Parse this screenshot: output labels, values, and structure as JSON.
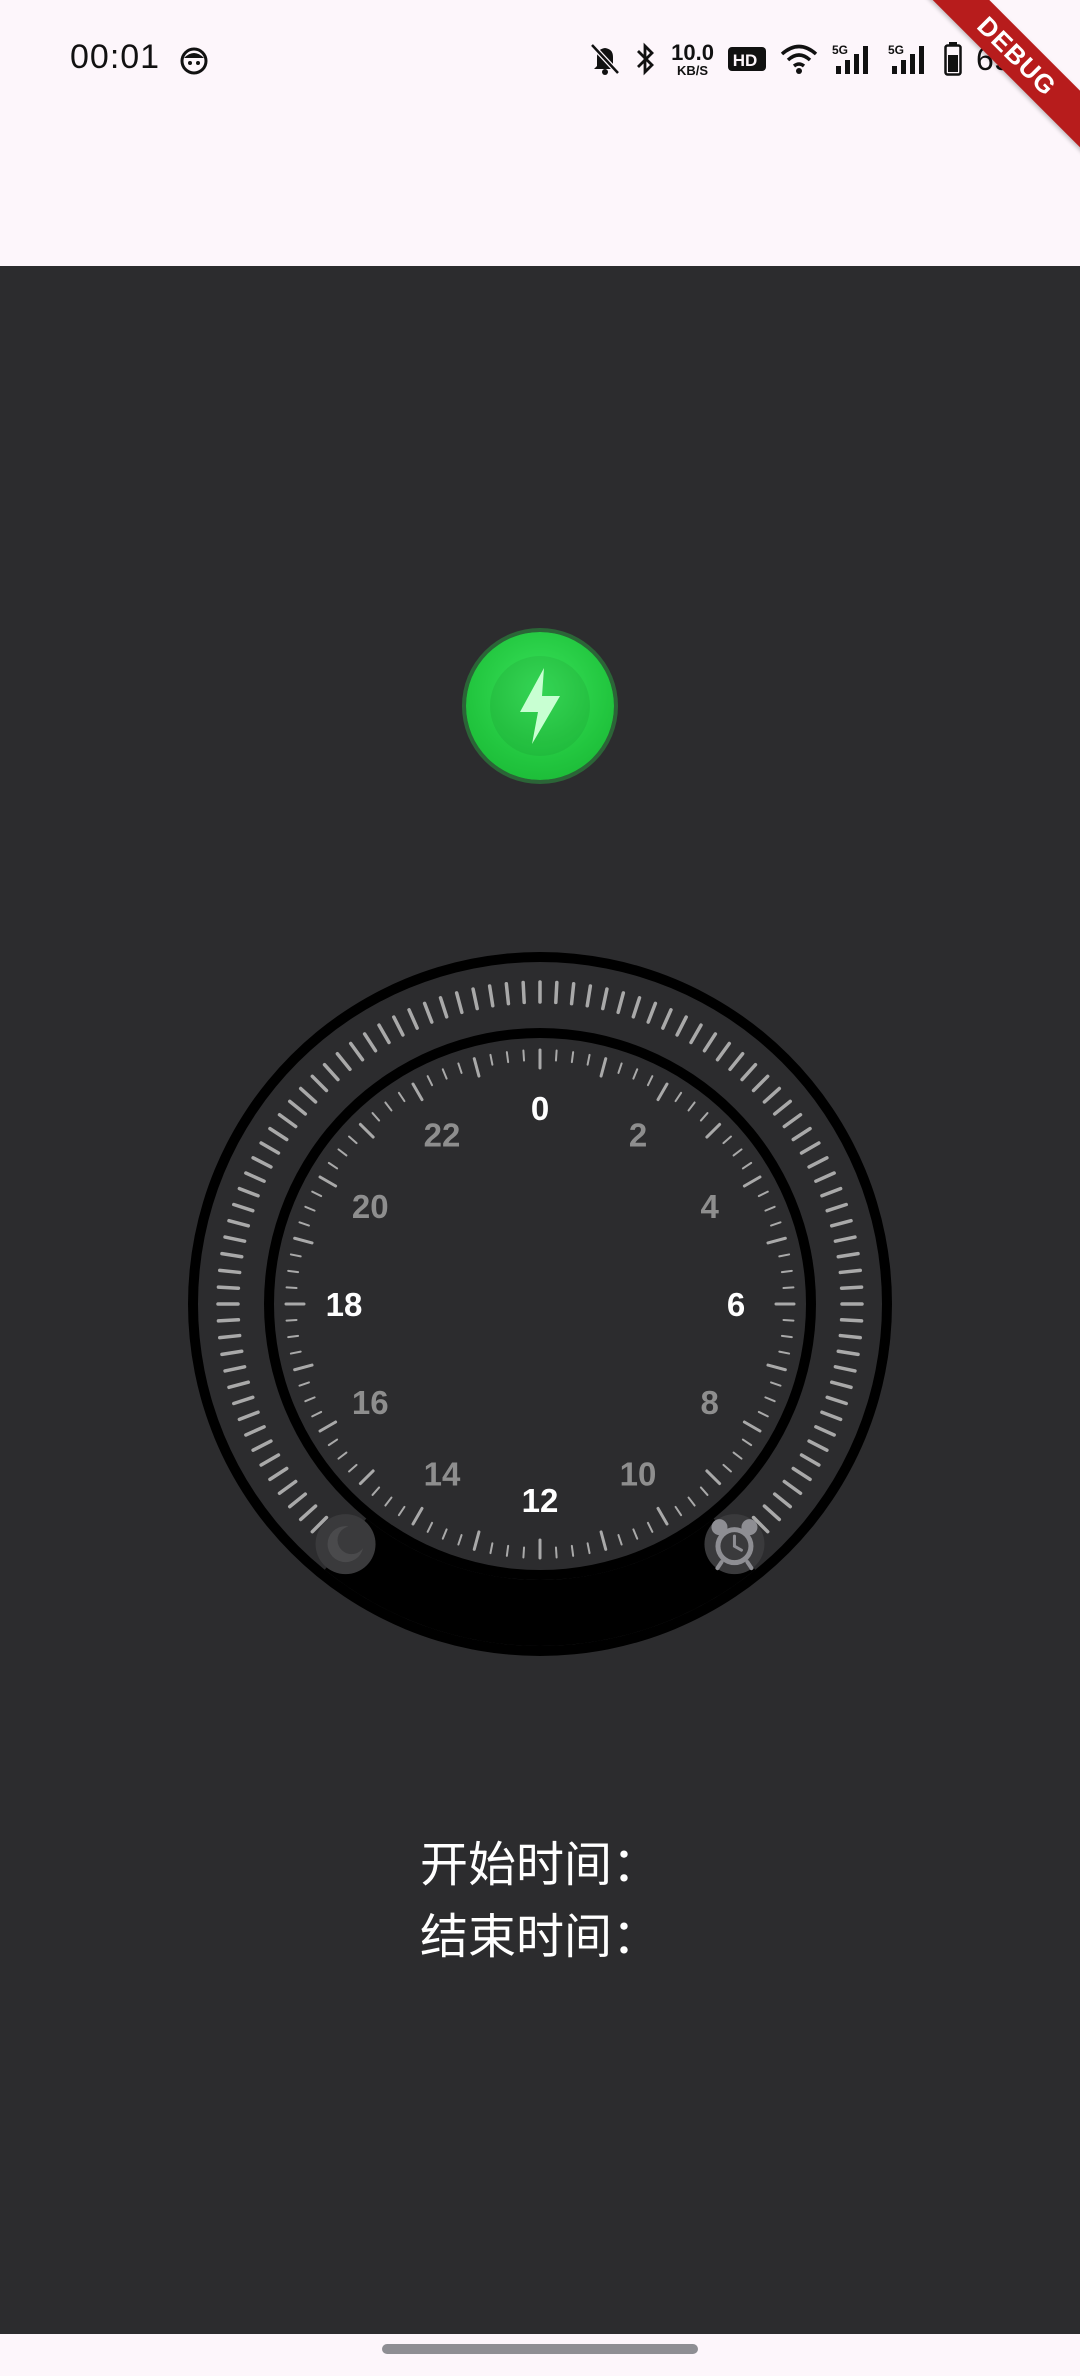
{
  "status_bar": {
    "time": "00:01",
    "net_speed_value": "10.0",
    "net_speed_unit": "KB/S",
    "hd_badge": "HD",
    "signal_5g_1": "5G",
    "signal_5g_2": "5G",
    "battery_percent": "69%",
    "icons": [
      "face-icon",
      "mute-bell-icon",
      "bluetooth-icon",
      "hd-icon",
      "wifi-icon",
      "cellular-icon",
      "cellular-icon",
      "battery-icon"
    ]
  },
  "debug_banner": "DEBUG",
  "charge_button": {
    "icon": "lightning-bolt-icon",
    "color": "#2bd249"
  },
  "dial": {
    "hour_labels": [
      {
        "text": "0",
        "hour": 0,
        "emphasis": true
      },
      {
        "text": "2",
        "hour": 2,
        "emphasis": false
      },
      {
        "text": "4",
        "hour": 4,
        "emphasis": false
      },
      {
        "text": "6",
        "hour": 6,
        "emphasis": true
      },
      {
        "text": "8",
        "hour": 8,
        "emphasis": false
      },
      {
        "text": "10",
        "hour": 10,
        "emphasis": false
      },
      {
        "text": "12",
        "hour": 12,
        "emphasis": true
      },
      {
        "text": "14",
        "hour": 14,
        "emphasis": false
      },
      {
        "text": "16",
        "hour": 16,
        "emphasis": false
      },
      {
        "text": "18",
        "hour": 18,
        "emphasis": true
      },
      {
        "text": "20",
        "hour": 20,
        "emphasis": false
      },
      {
        "text": "22",
        "hour": 22,
        "emphasis": false
      }
    ],
    "start_handle_icon": "moon-icon",
    "end_handle_icon": "alarm-clock-icon",
    "colors": {
      "background": "#2c2c2e",
      "ring": "#000000",
      "tick": "#a9a9a9",
      "label_primary": "#ffffff",
      "label_secondary": "#8e8e8e"
    }
  },
  "labels": {
    "start_time": "开始时间：",
    "end_time": "结束时间："
  }
}
